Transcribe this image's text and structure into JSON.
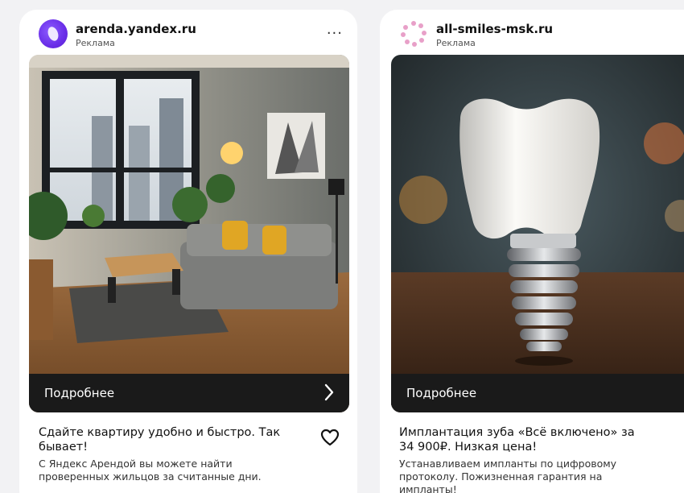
{
  "ads": [
    {
      "site": "arenda.yandex.ru",
      "label": "Реклама",
      "more_menu": "...",
      "cta": "Подробнее",
      "cta_icon": "chevron-right-icon",
      "title": "Сдайте квартиру удобно и быстро. Так бывает!",
      "description": "С Яндекс Арендой вы можете найти проверенных жильцов за считанные дни.",
      "logo_color": "#6a2ee8"
    },
    {
      "site": "all-smiles-msk.ru",
      "label": "Реклама",
      "cta": "Подробнее",
      "title": "Имплантация зуба «Всё включено» за 34 900₽. Низкая цена!",
      "description": "Устанавливаем импланты по цифровому протоколу. Пожизненная гарантия на импланты!",
      "logo_color": "#e8a0c8"
    }
  ]
}
